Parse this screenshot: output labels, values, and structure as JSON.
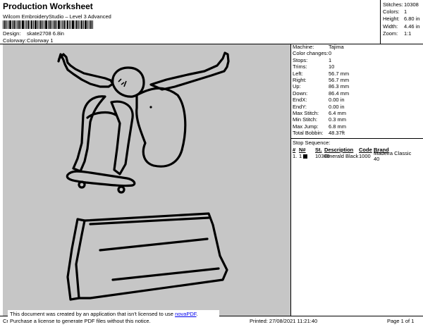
{
  "header": {
    "title": "Production Worksheet",
    "subtitle": "Wilcom EmbroideryStudio – Level 3 Advanced",
    "design_label": "Design:",
    "design_value": "skate2708 6.8in",
    "colorway_label": "Colorway:",
    "colorway_value": "Colorway 1"
  },
  "stats": [
    {
      "label": "Stitches:",
      "value": "10308"
    },
    {
      "label": "Colors:",
      "value": "1"
    },
    {
      "label": "Height:",
      "value": "6.80 in"
    },
    {
      "label": "Width:",
      "value": "4.46 in"
    },
    {
      "label": "Zoom:",
      "value": "1:1"
    }
  ],
  "info": [
    {
      "label": "Machine:",
      "value": "Tajima"
    },
    {
      "label": "Color changes:",
      "value": "0"
    },
    {
      "label": "Stops:",
      "value": "1"
    },
    {
      "label": "Trims:",
      "value": "10"
    },
    {
      "label": "Left:",
      "value": "56.7 mm"
    },
    {
      "label": "Right:",
      "value": "56.7 mm"
    },
    {
      "label": "Up:",
      "value": "86.3 mm"
    },
    {
      "label": "Down:",
      "value": "86.4 mm"
    },
    {
      "label": "EndX:",
      "value": "0.00 in"
    },
    {
      "label": "EndY:",
      "value": "0.00 in"
    },
    {
      "label": "Max Stitch:",
      "value": "6.4 mm"
    },
    {
      "label": "Min Stitch:",
      "value": "0.3 mm"
    },
    {
      "label": "Max Jump:",
      "value": "6.8 mm"
    },
    {
      "label": "Total Bobbin:",
      "value": "48.37ft"
    }
  ],
  "stop_sequence": {
    "title": "Stop Sequence:",
    "headers": [
      "#",
      "N#",
      "St.",
      "Description",
      "Code",
      "Brand"
    ],
    "rows": [
      {
        "num": "1.",
        "needle": "1",
        "stitches": "10306",
        "description": "Emerald Black",
        "code": "1000",
        "brand": "Madeira Classic 40",
        "swatch_color": "#000000"
      }
    ]
  },
  "notice": {
    "line1": "This document was created by an application that isn't licensed to use ",
    "link": "novaPDF",
    "line1_end": ".",
    "line2": "Purchase a license to generate PDF files without this notice."
  },
  "footer": {
    "left": "Cr",
    "printed": "Printed: 27/08/2021 11:21:40",
    "page": "Page 1 of 1"
  },
  "colors": {
    "canvas_bg": "#c6c6c6",
    "thread": "#000000",
    "link": "#0000ee"
  }
}
